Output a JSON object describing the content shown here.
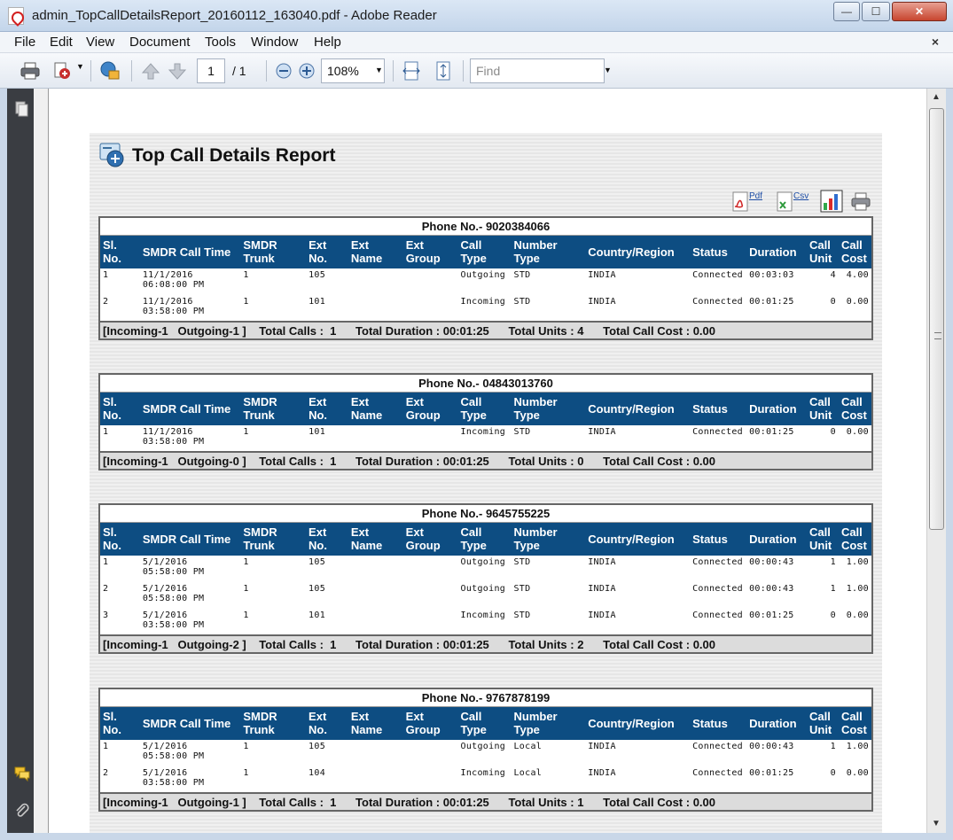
{
  "window": {
    "title": "admin_TopCallDetailsReport_20160112_163040.pdf - Adobe Reader",
    "minimize": "—",
    "maximize": "☐",
    "close": "✕"
  },
  "menu": {
    "items": [
      "File",
      "Edit",
      "View",
      "Document",
      "Tools",
      "Window",
      "Help"
    ],
    "close_doc": "×"
  },
  "toolbar": {
    "page_current": "1",
    "page_total": "/ 1",
    "zoom": "108%",
    "find_placeholder": "Find"
  },
  "report": {
    "title": "Top Call Details Report",
    "export_pdf": "Pdf",
    "export_csv": "Csv",
    "columns": [
      "Sl. No.",
      "SMDR Call Time",
      "SMDR Trunk",
      "Ext No.",
      "Ext Name",
      "Ext Group",
      "Call Type",
      "Number Type",
      "Country/Region",
      "Status",
      "Duration",
      "Call Unit",
      "Call Cost"
    ],
    "columns_alt": [
      "Sl. No.",
      "SMDR Call Time",
      "SMDR Trunk",
      "Ext No.",
      "Ext Name",
      "Ext Group",
      "Call Type",
      "Number Type",
      "Country/Region",
      "Status",
      "Duration",
      "Call Unit",
      "Call Cost"
    ],
    "groups": [
      {
        "phone": "Phone No.- 9020384066",
        "rows": [
          {
            "sl": "1",
            "time1": "11/1/2016",
            "time2": "06:08:00 PM",
            "trunk": "1",
            "ext": "105",
            "name": "",
            "group": "",
            "type": "Outgoing",
            "ntype": "STD",
            "country": "INDIA",
            "status": "Connected",
            "duration": "00:03:03",
            "unit": "4",
            "cost": "4.00"
          },
          {
            "sl": "2",
            "time1": "11/1/2016",
            "time2": "03:58:00 PM",
            "trunk": "1",
            "ext": "101",
            "name": "",
            "group": "",
            "type": "Incoming",
            "ntype": "STD",
            "country": "INDIA",
            "status": "Connected",
            "duration": "00:01:25",
            "unit": "0",
            "cost": "0.00"
          }
        ],
        "footer": "[Incoming-1   Outgoing-1 ]    Total Calls :  1      Total Duration : 00:01:25      Total Units : 4      Total Call Cost : 0.00"
      },
      {
        "phone": "Phone No.- 04843013760",
        "rows": [
          {
            "sl": "1",
            "time1": "11/1/2016",
            "time2": "03:58:00 PM",
            "trunk": "1",
            "ext": "101",
            "name": "",
            "group": "",
            "type": "Incoming",
            "ntype": "STD",
            "country": "INDIA",
            "status": "Connected",
            "duration": "00:01:25",
            "unit": "0",
            "cost": "0.00"
          }
        ],
        "footer": "[Incoming-1   Outgoing-0 ]    Total Calls :  1      Total Duration : 00:01:25      Total Units : 0      Total Call Cost : 0.00"
      },
      {
        "phone": "Phone No.- 9645755225",
        "rows": [
          {
            "sl": "1",
            "time1": "5/1/2016",
            "time2": "05:58:00 PM",
            "trunk": "1",
            "ext": "105",
            "name": "",
            "group": "",
            "type": "Outgoing",
            "ntype": "STD",
            "country": "INDIA",
            "status": "Connected",
            "duration": "00:00:43",
            "unit": "1",
            "cost": "1.00"
          },
          {
            "sl": "2",
            "time1": "5/1/2016",
            "time2": "05:58:00 PM",
            "trunk": "1",
            "ext": "105",
            "name": "",
            "group": "",
            "type": "Outgoing",
            "ntype": "STD",
            "country": "INDIA",
            "status": "Connected",
            "duration": "00:00:43",
            "unit": "1",
            "cost": "1.00"
          },
          {
            "sl": "3",
            "time1": "5/1/2016",
            "time2": "03:58:00 PM",
            "trunk": "1",
            "ext": "101",
            "name": "",
            "group": "",
            "type": "Incoming",
            "ntype": "STD",
            "country": "INDIA",
            "status": "Connected",
            "duration": "00:01:25",
            "unit": "0",
            "cost": "0.00"
          }
        ],
        "footer": "[Incoming-1   Outgoing-2 ]    Total Calls :  1      Total Duration : 00:01:25      Total Units : 2      Total Call Cost : 0.00"
      },
      {
        "phone": "Phone No.- 9767878199",
        "rows": [
          {
            "sl": "1",
            "time1": "5/1/2016",
            "time2": "05:58:00 PM",
            "trunk": "1",
            "ext": "105",
            "name": "",
            "group": "",
            "type": "Outgoing",
            "ntype": "Local",
            "country": "INDIA",
            "status": "Connected",
            "duration": "00:00:43",
            "unit": "1",
            "cost": "1.00"
          },
          {
            "sl": "2",
            "time1": "5/1/2016",
            "time2": "03:58:00 PM",
            "trunk": "1",
            "ext": "104",
            "name": "",
            "group": "",
            "type": "Incoming",
            "ntype": "Local",
            "country": "INDIA",
            "status": "Connected",
            "duration": "00:01:25",
            "unit": "0",
            "cost": "0.00"
          }
        ],
        "footer": "[Incoming-1   Outgoing-1 ]    Total Calls :  1      Total Duration : 00:01:25      Total Units : 1      Total Call Cost : 0.00"
      }
    ]
  },
  "colors": {
    "header_bg": "#0d4d82",
    "footer_bg": "#dcdcdc"
  }
}
